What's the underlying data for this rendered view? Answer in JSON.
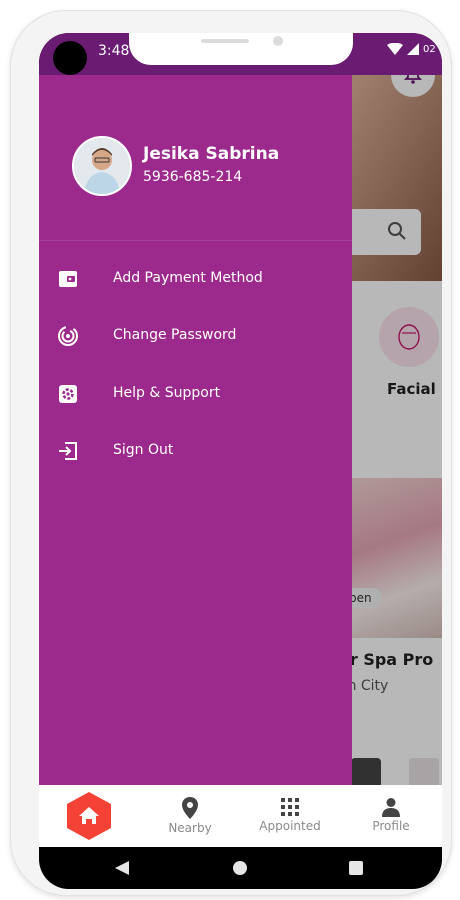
{
  "status_bar": {
    "time": "3:48"
  },
  "user": {
    "name": "Jesika Sabrina",
    "phone": "5936-685-214"
  },
  "menu": [
    {
      "label": "Add Payment Method",
      "icon": "wallet-icon"
    },
    {
      "label": "Change Password",
      "icon": "fingerprint-icon"
    },
    {
      "label": "Help & Support",
      "icon": "gear-icon"
    },
    {
      "label": "Sign Out",
      "icon": "sign-out-icon"
    }
  ],
  "background": {
    "category_label": "Facial",
    "badge": "pen",
    "card_title": "er Spa Pro",
    "card_subtitle": "on City",
    "notification_count": "02"
  },
  "bottom_nav": [
    {
      "label": "",
      "icon": "home-icon"
    },
    {
      "label": "Nearby",
      "icon": "location-pin-icon"
    },
    {
      "label": "Appointed",
      "icon": "grid-icon"
    },
    {
      "label": "Profile",
      "icon": "person-icon"
    }
  ],
  "colors": {
    "drawer": "#9c2a8d",
    "status_bar": "#6a1b72",
    "accent": "#f44336"
  }
}
